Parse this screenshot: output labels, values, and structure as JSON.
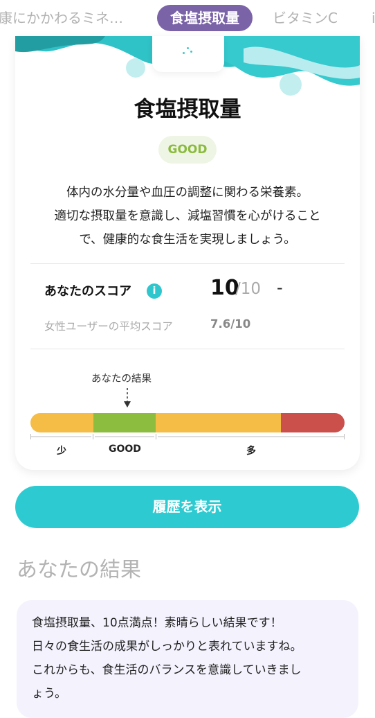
{
  "tabs": [
    {
      "label": "康にかかわるミネ…",
      "active": false
    },
    {
      "label": "食塩摂取量",
      "active": true
    },
    {
      "label": "ビタミンC",
      "active": false
    },
    {
      "label": "i",
      "active": false
    }
  ],
  "card": {
    "title": "食塩摂取量",
    "badge": "GOOD",
    "description_lines": [
      "体内の水分量や血圧の調整に関わる栄養素。",
      "適切な摂取量を意識し、減塩習慣を心がけること",
      "で、健康的な食生活を実現しましょう。"
    ],
    "score": {
      "label": "あなたのスコア",
      "value": "10",
      "max": "/10",
      "trend": "-",
      "avg_label": "女性ユーザーの平均スコア",
      "avg_value": "7.6/10"
    },
    "gauge": {
      "marker_label": "あなたの結果",
      "segments": [
        {
          "label": "少",
          "color": "#f5bd45"
        },
        {
          "label": "GOOD",
          "color": "#8dbd3e"
        },
        {
          "label": "多",
          "color": "#f5bd45"
        },
        {
          "label": "",
          "color": "#cb4f4a"
        }
      ]
    }
  },
  "history_button": "履歴を表示",
  "result": {
    "heading": "あなたの結果",
    "lines": [
      "食塩摂取量、10点満点！素晴らしい結果です！",
      "日々の食生活の成果がしっかりと表れていますね。",
      "これからも、食生活のバランスを意識していきまし",
      "ょう。"
    ]
  },
  "colors": {
    "accent": "#2dcbd1",
    "tab_active": "#7b63a8",
    "good": "#8dbd3e"
  }
}
